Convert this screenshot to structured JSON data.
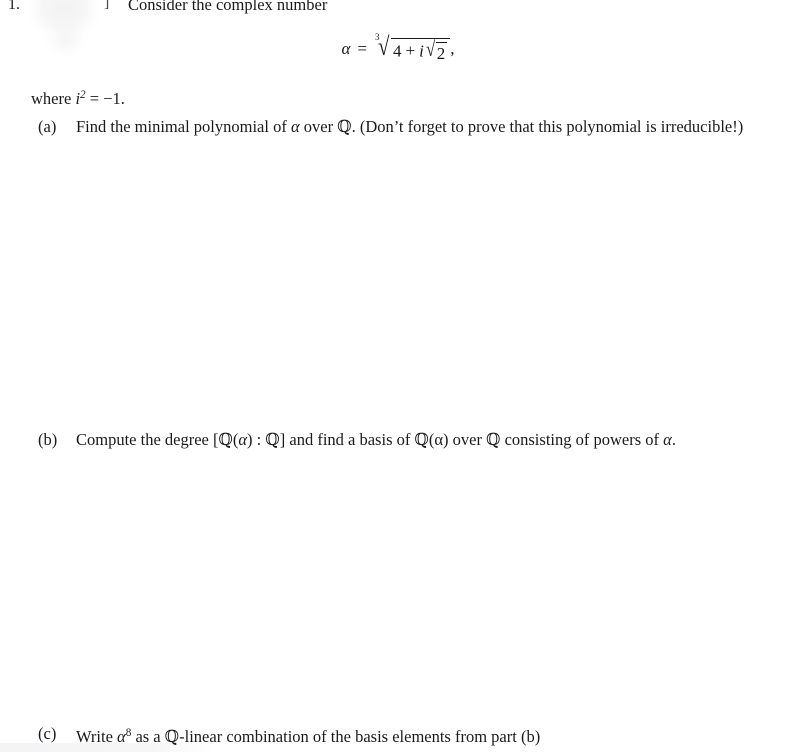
{
  "document": {
    "type": "math-exam-problem",
    "problem_number": "1.",
    "points_bracket": "]",
    "stem_text": "Consider the complex number",
    "where_clause": {
      "prefix": "where",
      "variable": "i",
      "exponent": "2",
      "equals": "=",
      "value": "−1."
    }
  },
  "equation": {
    "lhs": "α",
    "equals": "=",
    "root_index": "3",
    "radicand_first": "4",
    "plus": "+",
    "imaginary_unit": "i",
    "inner_root_index": "",
    "inner_radicand": "2",
    "trailing_punctuation": ",",
    "plain_text": "α = ∛(4 + i√2),"
  },
  "parts": [
    {
      "marker": "(a)",
      "text": "Find the minimal polynomial of α over ℚ. (Don’t forget to prove that this polynomial is irreducible!)",
      "segments": {
        "s1": "Find the minimal polynomial of ",
        "alpha": "α",
        "s2": " over ",
        "Q": "ℚ",
        "s3": ". (Don’t forget to prove that this polynomial is irreducible!)"
      }
    },
    {
      "marker": "(b)",
      "text": "Compute the degree [ℚ(α) : ℚ] and find a basis of ℚ(α) over ℚ consisting of powers of α.",
      "segments": {
        "s1": "Compute the degree [",
        "Q1": "ℚ",
        "paren_open": "(",
        "alpha1": "α",
        "paren_close": ")",
        "colon": " : ",
        "Q2": "ℚ",
        "bracket_close": "] and find a basis of ",
        "Q3": "ℚ",
        "s2": "(α) over ",
        "Q4": "ℚ",
        "s3": " consisting of powers of ",
        "alpha2": "α",
        "period": "."
      }
    },
    {
      "marker": "(c)",
      "text": "Write α8 as a ℚ-linear combination of the basis elements from part (b)",
      "segments": {
        "s1": "Write ",
        "alpha": "α",
        "power": "8",
        "s2": " as a ",
        "Q": "ℚ",
        "s3": "-linear combination of the basis elements from part (b)"
      }
    }
  ],
  "colors": {
    "text": "#1a1a1a",
    "page_background": "#ffffff",
    "artifact_gray": "#f4f4f5"
  }
}
